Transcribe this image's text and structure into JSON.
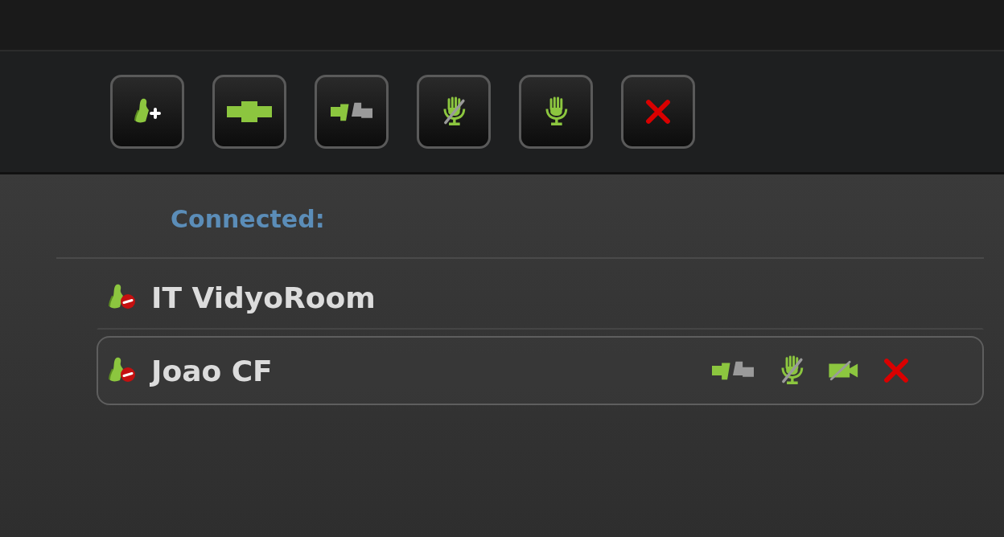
{
  "toolbar": [
    {
      "kind": "add-person"
    },
    {
      "kind": "connect"
    },
    {
      "kind": "disconnect"
    },
    {
      "kind": "mic-off"
    },
    {
      "kind": "mic"
    },
    {
      "kind": "close"
    }
  ],
  "section_title": "Connected:",
  "participants": [
    {
      "name": "IT VidyoRoom",
      "selected": false
    },
    {
      "name": "Joao CF",
      "selected": true
    }
  ]
}
